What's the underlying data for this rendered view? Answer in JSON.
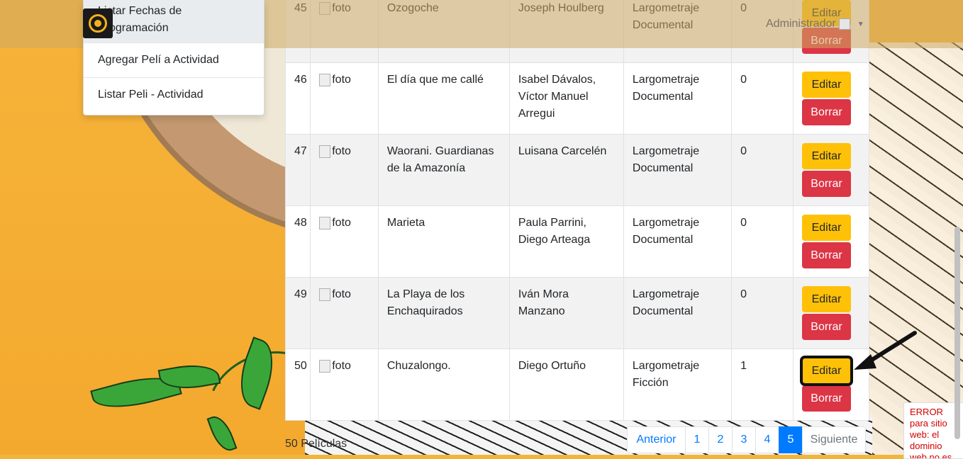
{
  "navbar": {
    "user_label": "Administrador"
  },
  "menu": {
    "items": [
      {
        "label": "Listar Fechas de Programación"
      },
      {
        "label": "Agregar Pelí a Actividad"
      },
      {
        "label": "Listar Peli - Actividad"
      }
    ]
  },
  "table": {
    "img_alt": "foto",
    "edit_label": "Editar",
    "delete_label": "Borrar",
    "rows": [
      {
        "id": "45",
        "title": "Ozogoche",
        "director": "Joseph Houlberg",
        "genre": "Largometraje Documental",
        "num": "0"
      },
      {
        "id": "46",
        "title": "El día que me callé",
        "director": "Isabel Dávalos, Víctor Manuel Arregui",
        "genre": "Largometraje Documental",
        "num": "0"
      },
      {
        "id": "47",
        "title": "Waorani. Guardianas de la Amazonía",
        "director": "Luisana Carcelén",
        "genre": "Largometraje Documental",
        "num": "0"
      },
      {
        "id": "48",
        "title": "Marieta",
        "director": "Paula Parrini, Diego Arteaga",
        "genre": "Largometraje Documental",
        "num": "0"
      },
      {
        "id": "49",
        "title": "La Playa de los Enchaquirados",
        "director": "Iván Mora Manzano",
        "genre": "Largometraje Documental",
        "num": "0"
      },
      {
        "id": "50",
        "title": "Chuzalongo.",
        "director": "Diego Ortuño",
        "genre": "Largometraje Ficción",
        "num": "1"
      }
    ]
  },
  "footer": {
    "count_text": "50 Películas"
  },
  "pagination": {
    "prev": "Anterior",
    "pages": [
      "1",
      "2",
      "3",
      "4",
      "5"
    ],
    "active_page": "5",
    "next": "Siguiente"
  },
  "error_widget": {
    "text": "ERROR para sitio web: el dominio web no es"
  },
  "colors": {
    "edit": "#ffc107",
    "delete": "#dc3545",
    "page_active": "#007bff",
    "background": "#f2b53b"
  }
}
